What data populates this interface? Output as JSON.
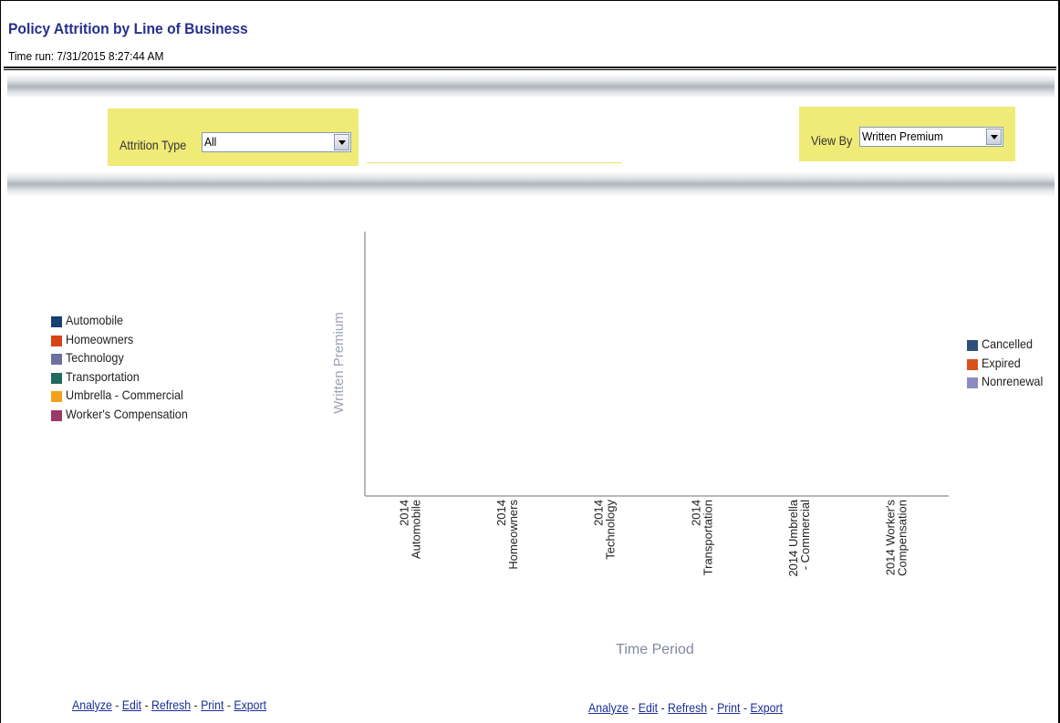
{
  "header": {
    "title": "Policy Attrition by Line of Business",
    "time_run": "Time run: 7/31/2015 8:27:44 AM"
  },
  "filters": {
    "attrition_type": {
      "label": "Attrition Type",
      "value": "All"
    },
    "view_by": {
      "label": "View By",
      "value": "Written Premium"
    }
  },
  "lob_legend": [
    {
      "label": "Automobile",
      "color": "#173f6f"
    },
    {
      "label": "Homeowners",
      "color": "#d84315"
    },
    {
      "label": "Technology",
      "color": "#6d6fa0"
    },
    {
      "label": "Transportation",
      "color": "#1f6b5e"
    },
    {
      "label": "Umbrella - Commercial",
      "color": "#f5a01a"
    },
    {
      "label": "Worker's Compensation",
      "color": "#9b3a66"
    }
  ],
  "type_legend": [
    {
      "label": "Cancelled",
      "color": "#2e4f7a"
    },
    {
      "label": "Expired",
      "color": "#d9531e"
    },
    {
      "label": "Nonrenewal",
      "color": "#8a8cbf"
    }
  ],
  "chart_data": {
    "type": "bar",
    "title": "",
    "xlabel": "Time Period",
    "ylabel": "Written Premium",
    "categories": [
      [
        "2014",
        "Automobile"
      ],
      [
        "2014",
        "Homeowners"
      ],
      [
        "2014",
        "Technology"
      ],
      [
        "2014",
        "Transportation"
      ],
      [
        "2014 Umbrella",
        "- Commercial"
      ],
      [
        "2014 Worker's",
        "Compensation"
      ]
    ],
    "series": [
      {
        "name": "Cancelled",
        "values": [
          null,
          null,
          null,
          null,
          null,
          null
        ]
      },
      {
        "name": "Expired",
        "values": [
          null,
          null,
          null,
          null,
          null,
          null
        ]
      },
      {
        "name": "Nonrenewal",
        "values": [
          null,
          null,
          null,
          null,
          null,
          null
        ]
      }
    ],
    "grid": false,
    "legend": "right"
  },
  "links": {
    "analyze": "Analyze",
    "edit": "Edit",
    "refresh": "Refresh",
    "print": "Print",
    "export": "Export",
    "sep": " - "
  }
}
